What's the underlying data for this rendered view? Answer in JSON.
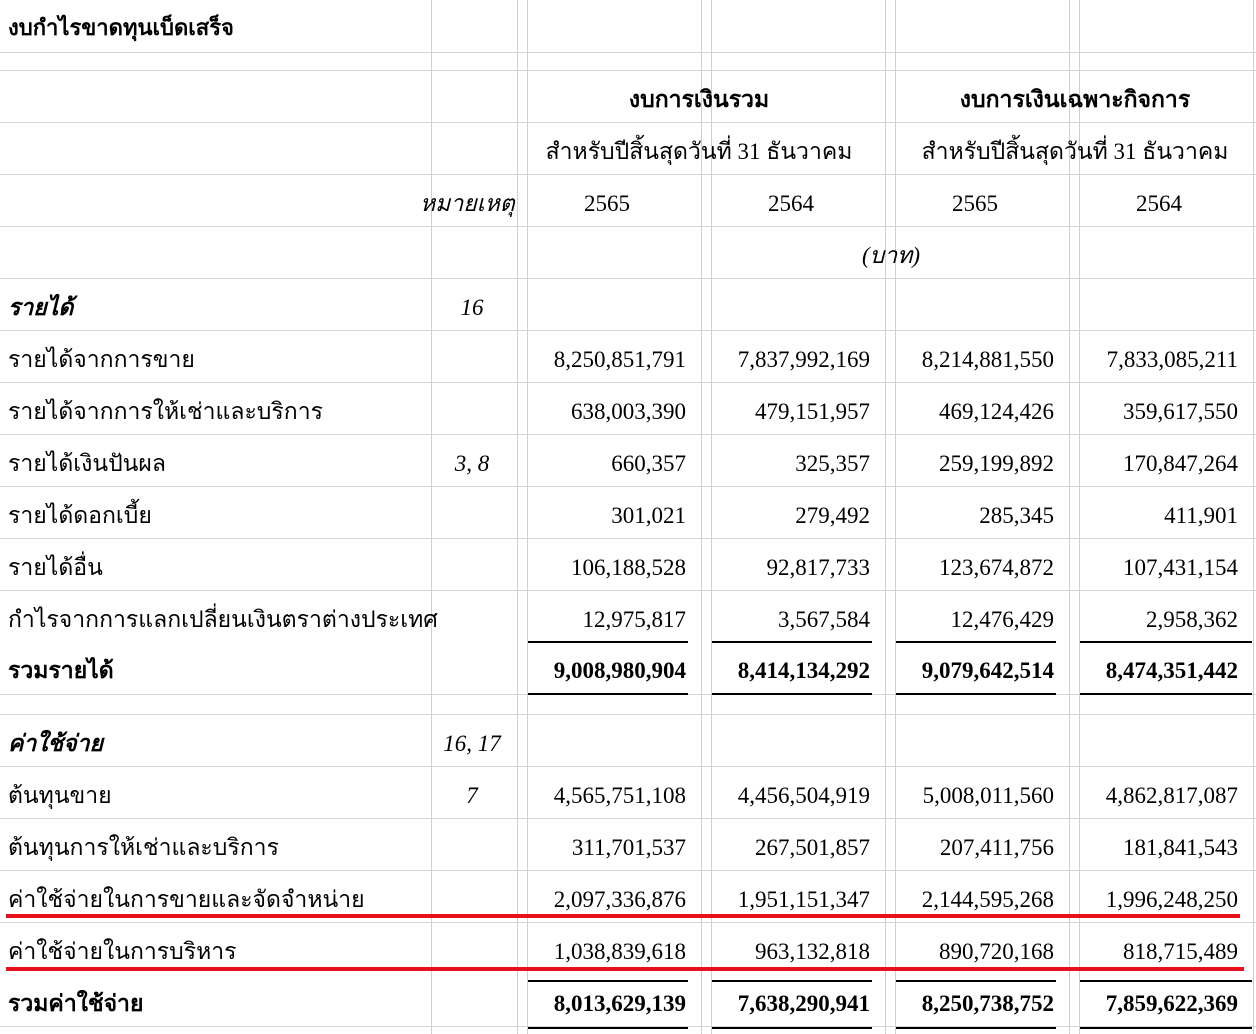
{
  "document_title": "งบกำไรขาดทุนเบ็ดเสร็จ",
  "groups": {
    "consolidated": "งบการเงินรวม",
    "separate": "งบการเงินเฉพาะกิจการ",
    "period": "สำหรับปีสิ้นสุดวันที่ 31 ธันวาคม"
  },
  "note_header": "หมายเหตุ",
  "years": [
    "2565",
    "2564",
    "2565",
    "2564"
  ],
  "unit": "(บาท)",
  "revenue_section": {
    "label": "รายได้",
    "note": "16"
  },
  "revenue_rows": [
    {
      "label": "รายได้จากการขาย",
      "note": "",
      "values": [
        "8,250,851,791",
        "7,837,992,169",
        "8,214,881,550",
        "7,833,085,211"
      ]
    },
    {
      "label": "รายได้จากการให้เช่าและบริการ",
      "note": "",
      "values": [
        "638,003,390",
        "479,151,957",
        "469,124,426",
        "359,617,550"
      ]
    },
    {
      "label": "รายได้เงินปันผล",
      "note": "3, 8",
      "values": [
        "660,357",
        "325,357",
        "259,199,892",
        "170,847,264"
      ]
    },
    {
      "label": "รายได้ดอกเบี้ย",
      "note": "",
      "values": [
        "301,021",
        "279,492",
        "285,345",
        "411,901"
      ]
    },
    {
      "label": "รายได้อื่น",
      "note": "",
      "values": [
        "106,188,528",
        "92,817,733",
        "123,674,872",
        "107,431,154"
      ]
    },
    {
      "label": "กำไรจากการแลกเปลี่ยนเงินตราต่างประเทศ",
      "note": "",
      "values": [
        "12,975,817",
        "3,567,584",
        "12,476,429",
        "2,958,362"
      ]
    }
  ],
  "revenue_total": {
    "label": "รวมรายได้",
    "values": [
      "9,008,980,904",
      "8,414,134,292",
      "9,079,642,514",
      "8,474,351,442"
    ]
  },
  "expense_section": {
    "label": "ค่าใช้จ่าย",
    "note": "16, 17"
  },
  "expense_rows": [
    {
      "label": "ต้นทุนขาย",
      "note": "7",
      "values": [
        "4,565,751,108",
        "4,456,504,919",
        "5,008,011,560",
        "4,862,817,087"
      ]
    },
    {
      "label": "ต้นทุนการให้เช่าและบริการ",
      "note": "",
      "values": [
        "311,701,537",
        "267,501,857",
        "207,411,756",
        "181,841,543"
      ]
    },
    {
      "label": "ค่าใช้จ่ายในการขายและจัดจำหน่าย",
      "note": "",
      "values": [
        "2,097,336,876",
        "1,951,151,347",
        "2,144,595,268",
        "1,996,248,250"
      ]
    },
    {
      "label": "ค่าใช้จ่ายในการบริหาร",
      "note": "",
      "values": [
        "1,038,839,618",
        "963,132,818",
        "890,720,168",
        "818,715,489"
      ]
    }
  ],
  "expense_total": {
    "label": "รวมค่าใช้จ่าย",
    "values": [
      "8,013,629,139",
      "7,638,290,941",
      "8,250,738,752",
      "7,859,622,369"
    ]
  },
  "highlight_color": "#e8101a"
}
